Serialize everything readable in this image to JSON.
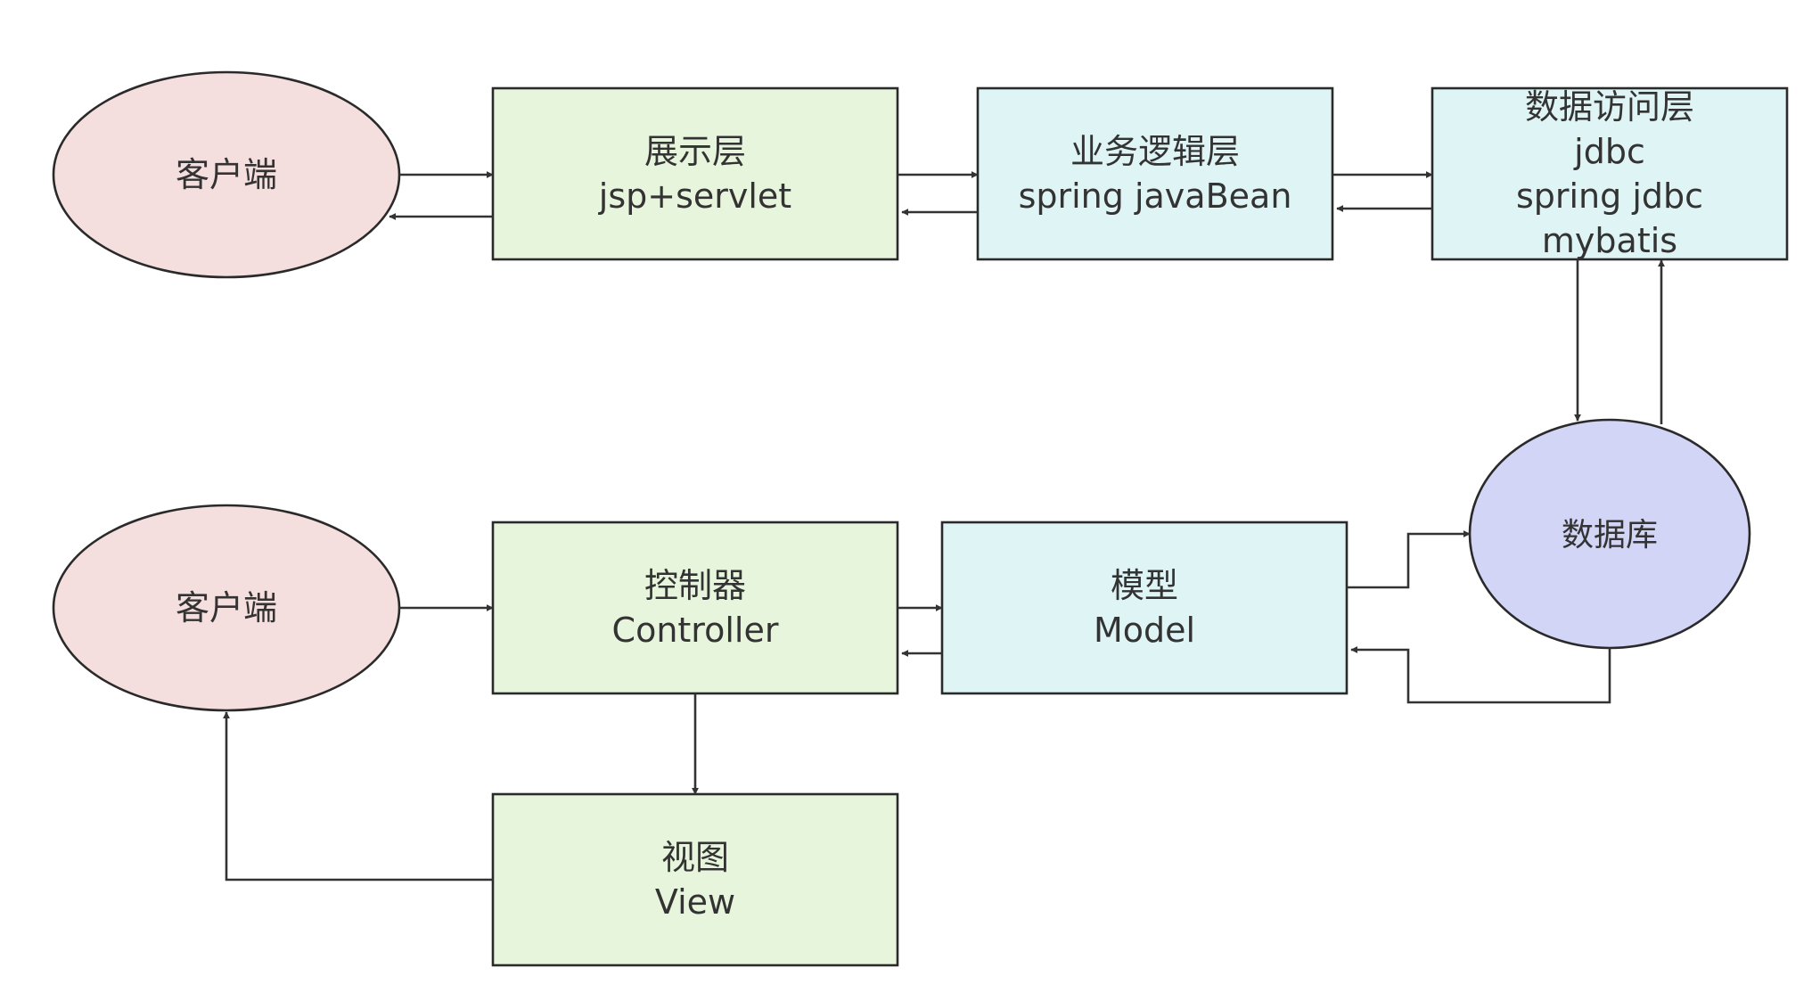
{
  "colors": {
    "client": "#f4dede",
    "presentation": "#e7f5dc",
    "service": "#dff4f4",
    "database": "#d3d5f6",
    "line": "#333333"
  },
  "top_row": {
    "client": {
      "label": "客户端"
    },
    "presentation": {
      "line1": "展示层",
      "line2": "jsp+servlet"
    },
    "business": {
      "line1": "业务逻辑层",
      "line2": "spring javaBean"
    },
    "data_access": {
      "line1": "数据访问层",
      "line2": "jdbc",
      "line3": "spring jdbc",
      "line4": "mybatis"
    }
  },
  "database": {
    "label": "数据库"
  },
  "bottom_row": {
    "client": {
      "label": "客户端"
    },
    "controller": {
      "line1": "控制器",
      "line2": "Controller"
    },
    "model": {
      "line1": "模型",
      "line2": "Model"
    },
    "view": {
      "line1": "视图",
      "line2": "View"
    }
  }
}
